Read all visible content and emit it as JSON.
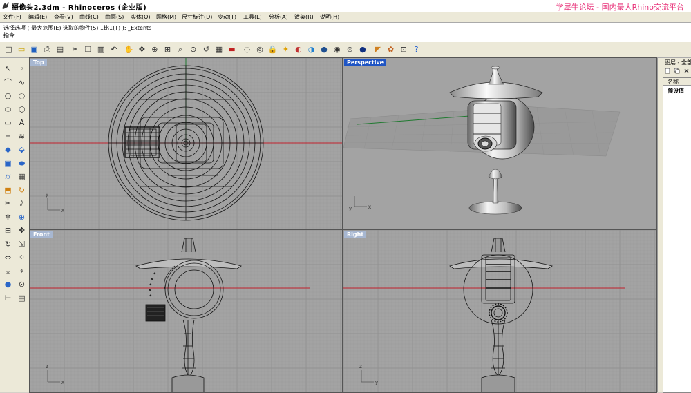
{
  "window": {
    "title": "摄像头2.3dm - Rhinoceros (企业版)",
    "watermark": "学犀牛论坛 - 国内最大Rhino交流平台"
  },
  "menu": [
    "文件(F)",
    "编辑(E)",
    "查看(V)",
    "曲线(C)",
    "曲面(S)",
    "实体(O)",
    "网格(M)",
    "尺寸标注(D)",
    "变动(T)",
    "工具(L)",
    "分析(A)",
    "渲染(R)",
    "说明(H)"
  ],
  "command": {
    "history": "选择选项 ( 最大范围(E) 选取的物件(S) 1比1(T) ): _Extents",
    "prompt_label": "指令:",
    "input_value": ""
  },
  "toolbar_icons": [
    "new-file-icon",
    "open-file-icon",
    "save-icon",
    "print-icon",
    "import-icon",
    "cut-icon",
    "copy-icon",
    "paste-icon",
    "undo-icon",
    "pan-hand-icon",
    "rotate-view-icon",
    "zoom-window-icon",
    "zoom-extents-icon",
    "zoom-selected-icon",
    "zoom-icon",
    "undo-view-icon",
    "four-viewports-icon",
    "car-icon",
    "hide-icon",
    "show-icon",
    "lock-icon",
    "light-icon",
    "color-icon",
    "material-icon",
    "rendered-sphere-icon",
    "shaded-sphere-icon",
    "wireframe-sphere-icon",
    "render-sphere-icon",
    "select-icon",
    "options-icon",
    "grid-snap-icon",
    "help-icon"
  ],
  "left_tools": [
    "point-icon",
    "select-points-icon",
    "polyline-icon",
    "curve-icon",
    "circle-icon",
    "arc-icon",
    "ellipse-icon",
    "polygon-icon",
    "rectangle-icon",
    "text-icon",
    "fillet-icon",
    "offset-icon",
    "surface-icon",
    "extrude-icon",
    "box-solid-icon",
    "boolean-union-icon",
    "cylinder-icon",
    "mesh-icon",
    "loft-icon",
    "revolve-icon",
    "trim-icon",
    "split-icon",
    "explode-icon",
    "join-icon",
    "group-icon",
    "move-icon",
    "rotate-icon",
    "scale-icon",
    "mirror-icon",
    "array-icon",
    "project-icon",
    "analyze-icon",
    "render-icon",
    "camera-icon",
    "dimension-icon",
    "layer-icon"
  ],
  "viewports": {
    "top": {
      "label": "Top",
      "ax1": "x",
      "ax2": "y"
    },
    "perspective": {
      "label": "Perspective",
      "ax1": "x",
      "ax2": "y"
    },
    "front": {
      "label": "Front",
      "ax1": "x",
      "ax2": "z"
    },
    "right": {
      "label": "Right",
      "ax1": "y",
      "ax2": "z"
    }
  },
  "layer_panel": {
    "title": "图层 - 全部",
    "column_name": "名称",
    "default_layer": "预设值"
  },
  "colors": {
    "viewport_bg": "#a3a3a3",
    "grid": "#999999",
    "grid_major": "#8c8c8c",
    "x_axis": "#c0202c",
    "y_axis": "#207a30",
    "active_label": "#1f55c4",
    "inactive_label": "#a7b7d1"
  }
}
